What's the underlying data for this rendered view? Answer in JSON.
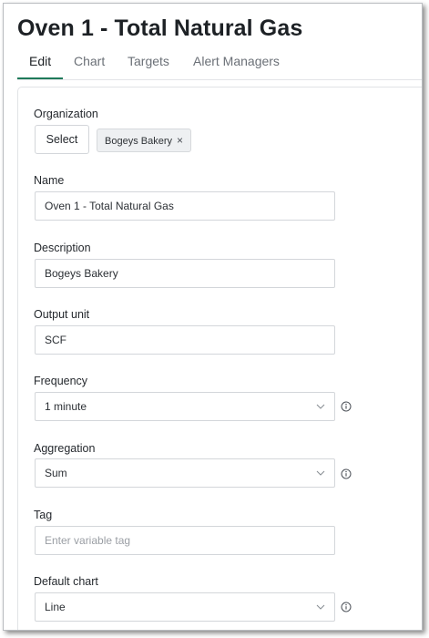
{
  "header": {
    "title": "Oven 1 - Total Natural Gas"
  },
  "tabs": [
    {
      "label": "Edit"
    },
    {
      "label": "Chart"
    },
    {
      "label": "Targets"
    },
    {
      "label": "Alert Managers"
    }
  ],
  "form": {
    "organization": {
      "label": "Organization",
      "select_label": "Select",
      "selected_chip": "Bogeys Bakery",
      "remove_glyph": "×"
    },
    "name": {
      "label": "Name",
      "value": "Oven 1 - Total Natural Gas"
    },
    "description": {
      "label": "Description",
      "value": "Bogeys Bakery"
    },
    "output_unit": {
      "label": "Output unit",
      "value": "SCF"
    },
    "frequency": {
      "label": "Frequency",
      "value": "1 minute"
    },
    "aggregation": {
      "label": "Aggregation",
      "value": "Sum"
    },
    "tag": {
      "label": "Tag",
      "value": "",
      "placeholder": "Enter variable tag"
    },
    "default_chart": {
      "label": "Default chart",
      "value": "Line"
    }
  },
  "colors": {
    "accent": "#1f7a5a",
    "border": "#d3d6da",
    "chip_bg": "#eef0f2"
  },
  "icons": {
    "dropdown": "chevron-down-icon",
    "info": "info-icon",
    "remove": "close-icon"
  }
}
